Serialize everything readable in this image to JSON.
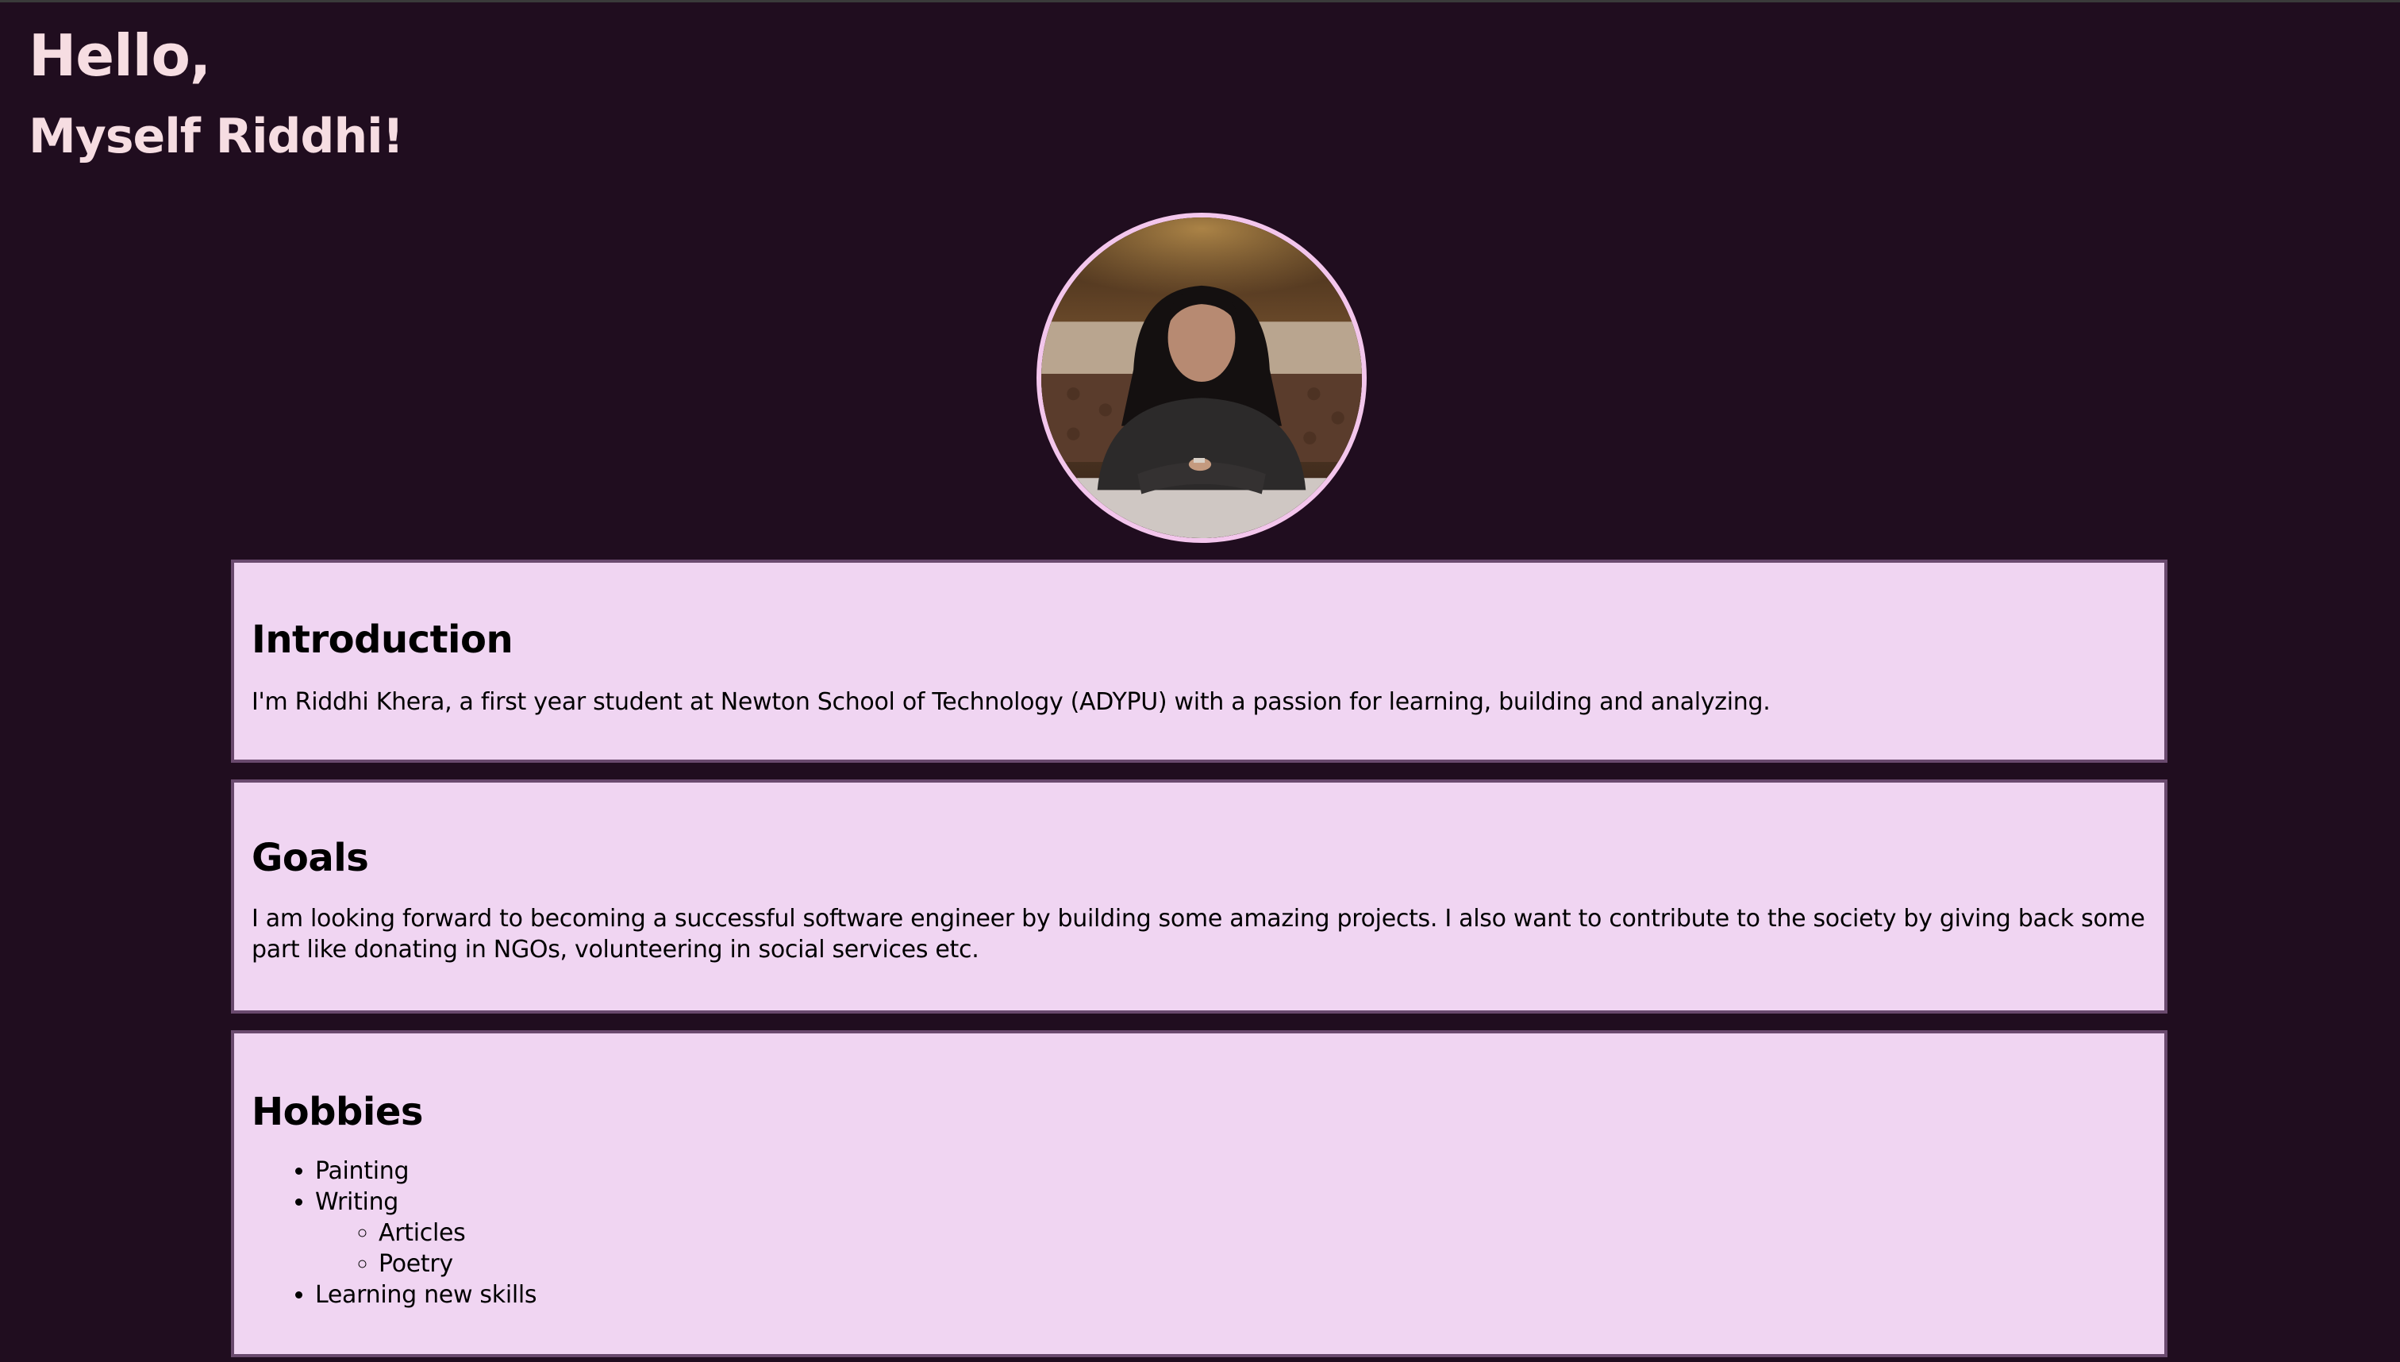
{
  "header": {
    "greeting_line1": "Hello,",
    "greeting_line2": "Myself Riddhi!"
  },
  "profile": {
    "photo_icon": "profile-photo",
    "border_color": "#f3c6ec"
  },
  "sections": {
    "introduction": {
      "title": "Introduction",
      "text": "I'm Riddhi Khera, a first year student at Newton School of Technology (ADYPU) with a passion for learning, building and analyzing."
    },
    "goals": {
      "title": "Goals",
      "text": "I am looking forward to becoming a successful software engineer by building some amazing projects. I also want to contribute to the society by giving back some part like donating in NGOs, volunteering in social services etc."
    },
    "hobbies": {
      "title": "Hobbies",
      "items": [
        {
          "label": "Painting"
        },
        {
          "label": "Writing",
          "subitems": [
            "Articles",
            "Poetry"
          ]
        },
        {
          "label": "Learning new skills"
        }
      ]
    }
  },
  "colors": {
    "background": "#200d1f",
    "heading_text": "#f6dde2",
    "card_background": "#f0d5f2",
    "card_border": "#6a4a6e"
  }
}
